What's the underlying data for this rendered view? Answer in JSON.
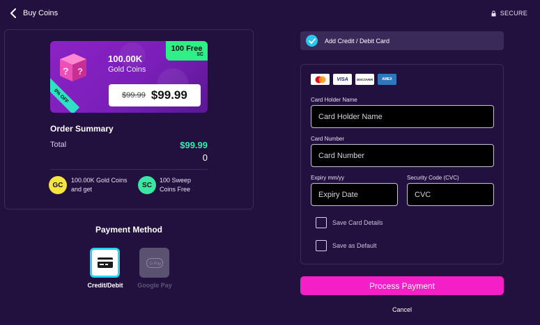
{
  "header": {
    "title": "Buy Coins",
    "secure_label": "SECURE"
  },
  "promo": {
    "free_badge_amount": "100 Free",
    "free_badge_unit": "SC",
    "gold_amount": "100.00K",
    "gold_label": "Gold Coins",
    "old_price": "$99.99",
    "new_price": "$99.99",
    "discount": "0% OFF"
  },
  "order_summary": {
    "title": "Order Summary",
    "total_label": "Total",
    "total_value": "$99.99",
    "secondary_value": "0",
    "gc_icon": "GC",
    "gc_text": "100.00K Gold Coins and get",
    "sc_icon": "SC",
    "sc_text": "100 Sweep Coins Free"
  },
  "payment_method": {
    "title": "Payment Method",
    "options": [
      {
        "label": "Credit/Debit",
        "icon": "credit-card-icon",
        "selected": true
      },
      {
        "label": "Google Pay",
        "icon": "google-pay-icon",
        "selected": false
      }
    ],
    "google_pay_icon_text": "G Pay"
  },
  "card_form": {
    "add_card_label": "Add Credit / Debit Card",
    "logos": [
      "mastercard",
      "VISA",
      "DISCOVER",
      "AMEX"
    ],
    "card_holder_label": "Card Holder Name",
    "card_holder_placeholder": "Card Holder Name",
    "card_number_label": "Card Number",
    "card_number_placeholder": "Card Number",
    "expiry_label": "Expiry mm/yy",
    "expiry_placeholder": "Expiry Date",
    "cvc_label": "Security Code (CVC)",
    "cvc_placeholder": "CVC",
    "save_card_label": "Save Card Details",
    "save_default_label": "Save as Default"
  },
  "actions": {
    "process_label": "Process Payment",
    "cancel_label": "Cancel"
  },
  "colors": {
    "background": "#22103f",
    "accent_pink": "#f51fc7",
    "accent_green": "#2ff0a8",
    "accent_cyan": "#27c6ee"
  }
}
